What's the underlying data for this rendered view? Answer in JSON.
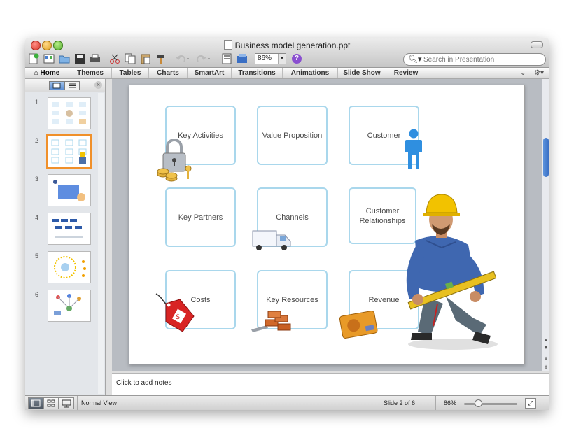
{
  "window": {
    "title": "Business model generation.ppt"
  },
  "toolbar": {
    "zoom": "86%",
    "help_label": "?",
    "search_placeholder": "Search in Presentation"
  },
  "ribbon": {
    "tabs": [
      "Home",
      "Themes",
      "Tables",
      "Charts",
      "SmartArt",
      "Transitions",
      "Animations",
      "Slide Show",
      "Review"
    ]
  },
  "slides_panel": {
    "thumbnails": [
      "1",
      "2",
      "3",
      "4",
      "5",
      "6"
    ],
    "selected_index": 2
  },
  "slide": {
    "boxes": [
      "Key Activities",
      "Value Proposition",
      "Customer",
      "Key Partners",
      "Channels",
      "Customer Relationships",
      "Costs",
      "Key Resources",
      "Revenue"
    ]
  },
  "notes": {
    "placeholder": "Click to add notes"
  },
  "status": {
    "view": "Normal View",
    "slide_position": "Slide 2 of 6",
    "zoom": "86%"
  },
  "colors": {
    "box_border": "#a9d7ec",
    "selected_thumb": "#f0902a",
    "scroll_accent": "#3a6fc4"
  }
}
